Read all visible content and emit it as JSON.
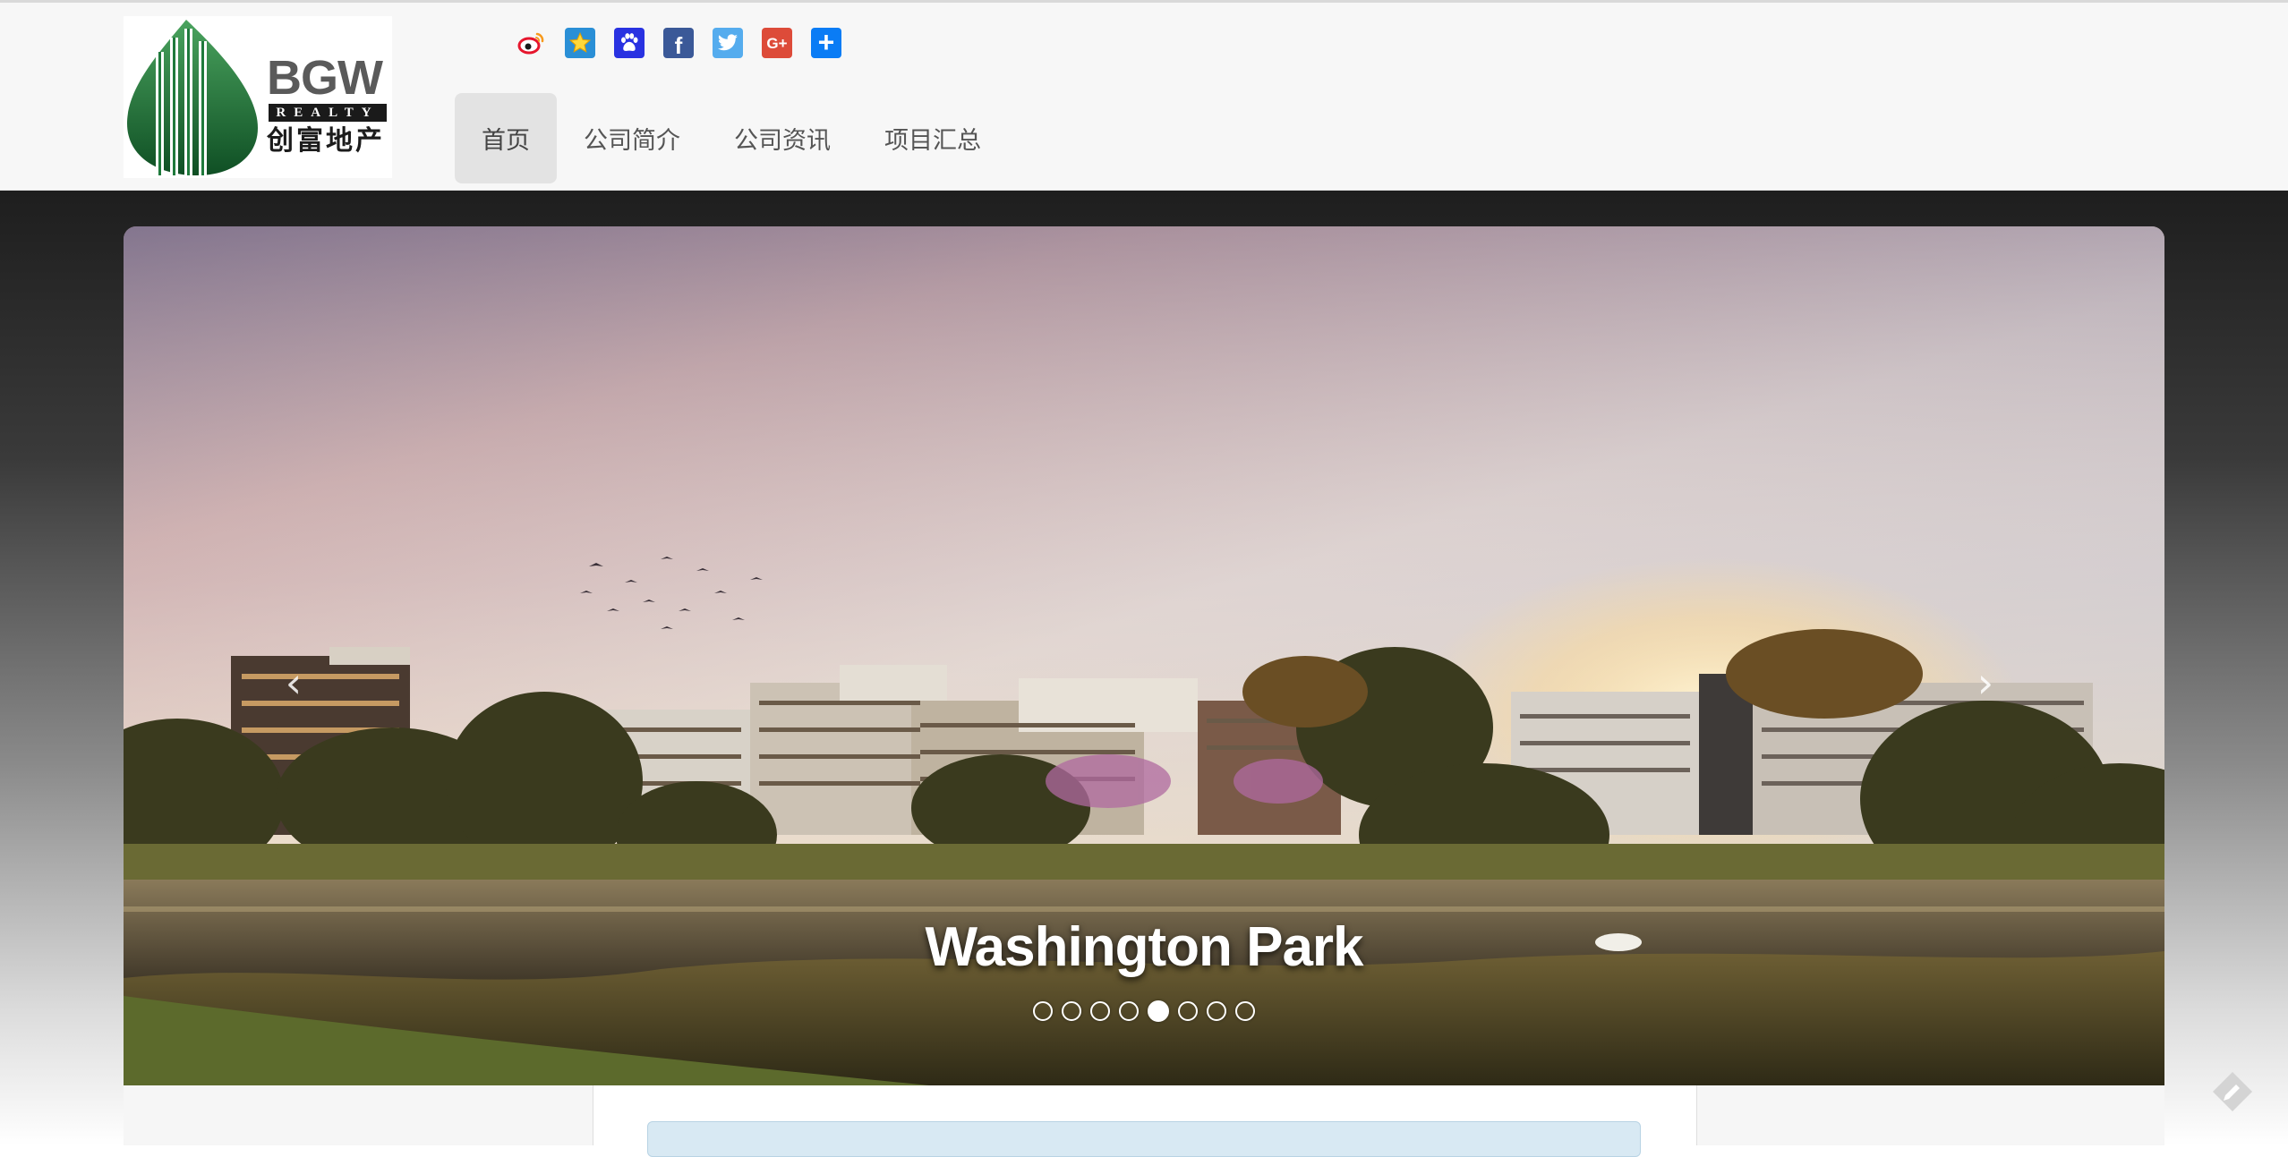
{
  "header": {
    "logo": {
      "wordmark": "BGW",
      "tagline": "REALTY",
      "name_cn": "创富地产"
    },
    "social": [
      {
        "name": "weibo",
        "icon": "weibo-icon",
        "color": "#ffffff",
        "glyph": ""
      },
      {
        "name": "favorite",
        "icon": "star-icon",
        "color": "#2a8fd6",
        "glyph": ""
      },
      {
        "name": "baidu",
        "icon": "paw-icon",
        "color": "#2932e1",
        "glyph": ""
      },
      {
        "name": "facebook",
        "icon": "facebook-icon",
        "color": "#3b5998",
        "glyph": "f"
      },
      {
        "name": "twitter",
        "icon": "twitter-icon",
        "color": "#55acee",
        "glyph": ""
      },
      {
        "name": "google-plus",
        "icon": "google-plus-icon",
        "color": "#dd4b39",
        "glyph": "G+"
      },
      {
        "name": "share-more",
        "icon": "plus-icon",
        "color": "#0a7cf5",
        "glyph": "+"
      }
    ],
    "nav": [
      {
        "label": "首页",
        "active": true
      },
      {
        "label": "公司简介",
        "active": false
      },
      {
        "label": "公司资讯",
        "active": false
      },
      {
        "label": "项目汇总",
        "active": false
      }
    ]
  },
  "carousel": {
    "caption": "Washington Park",
    "prev_label": "‹",
    "next_label": "›",
    "slide_count": 8,
    "active_slide_index": 4
  },
  "colors": {
    "accent_green": "#1f7a3c",
    "caption_text": "#ffffff",
    "nav_active_bg": "#e3e3e3"
  }
}
